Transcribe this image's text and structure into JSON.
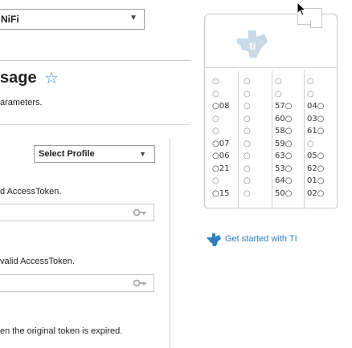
{
  "header": {
    "wifi_select_value": "NiFi",
    "wifi_select_arrow": "▼"
  },
  "page": {
    "title": "sage",
    "star_icon": "star-icon",
    "subtitle": "arameters."
  },
  "profile": {
    "select_value": "Select Profile",
    "select_arrow": "▼"
  },
  "fields": {
    "access_token_label": "d AccessToken.",
    "refresh_token_label": "valid AccessToken.",
    "expired_note": "en the original token is expired."
  },
  "board": {
    "pins": {
      "r1": [
        "○",
        "○",
        "○",
        "○"
      ],
      "r2": [
        "○",
        "○",
        "○",
        "○"
      ],
      "r3": [
        "○08",
        "○",
        "57○",
        "04○"
      ],
      "r4": [
        "○",
        "○",
        "60○",
        "03○"
      ],
      "r5": [
        "○",
        "○",
        "58○",
        "61○"
      ],
      "r6": [
        "○07",
        "○",
        "59○",
        "○"
      ],
      "r7": [
        "○06",
        "○",
        "63○",
        "05○"
      ],
      "r8": [
        "○21",
        "○",
        "53○",
        "62○"
      ],
      "r9": [
        "○",
        "○",
        "64○",
        "01○"
      ],
      "r10": [
        "○15",
        "○",
        "50○",
        "02○"
      ]
    }
  },
  "get_started": {
    "label": "Get started with TI",
    "accent": "#2a7fc1"
  }
}
